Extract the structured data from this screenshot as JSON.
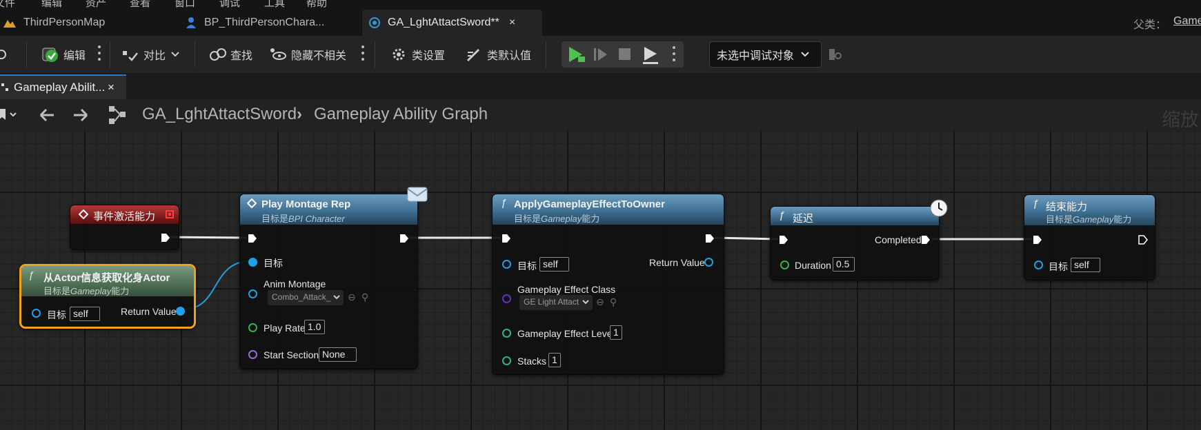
{
  "menu": [
    "文件",
    "编辑",
    "资产",
    "查看",
    "窗口",
    "调试",
    "工具",
    "帮助"
  ],
  "tabs": [
    {
      "label": "ThirdPersonMap"
    },
    {
      "label": "BP_ThirdPersonChara..."
    },
    {
      "label": "GA_LghtAttactSword**",
      "close": "×"
    }
  ],
  "parent_class": {
    "label": "父类：",
    "value": "Game"
  },
  "toolbar": {
    "compile": "编辑",
    "diff": "对比",
    "find": "查找",
    "hide_unrelated": "隐藏不相关",
    "class_settings": "类设置",
    "class_defaults": "类默认值",
    "debug_select": "未选中调试对象"
  },
  "graph_tab": {
    "label": "Gameplay Abilit...",
    "close": "×"
  },
  "breadcrumb": {
    "asset": "GA_LghtAttactSword",
    "separator": "›",
    "graph": "Gameplay Ability Graph"
  },
  "zoom_label": "缩放",
  "nodes": {
    "event": {
      "title": "事件激活能力"
    },
    "get_avatar": {
      "title": "从Actor信息获取化身Actor",
      "subtitle_prefix": "目标是",
      "subtitle_class": "Gameplay",
      "subtitle_suffix": "能力",
      "target_label": "目标",
      "target_value": "self",
      "return_label": "Return Value"
    },
    "play_montage": {
      "title": "Play Montage Rep",
      "subtitle_prefix": "目标是",
      "subtitle_class": "BPI Character",
      "target_label": "目标",
      "anim_montage_label": "Anim Montage",
      "anim_montage_value": "Combo_Attack_",
      "play_rate_label": "Play Rate",
      "play_rate_value": "1.0",
      "start_section_label": "Start Section",
      "start_section_value": "None"
    },
    "apply_effect": {
      "title": "ApplyGameplayEffectToOwner",
      "subtitle_prefix": "目标是",
      "subtitle_class": "Gameplay",
      "subtitle_suffix": "能力",
      "target_label": "目标",
      "target_value": "self",
      "return_label": "Return Value",
      "effect_class_label": "Gameplay Effect Class",
      "effect_class_value": "GE Light Attact",
      "effect_level_label": "Gameplay Effect Level",
      "effect_level_value": "1",
      "stacks_label": "Stacks",
      "stacks_value": "1"
    },
    "delay": {
      "title": "延迟",
      "completed_label": "Completed",
      "duration_label": "Duration",
      "duration_value": "0.5"
    },
    "end_ability": {
      "title": "结束能力",
      "subtitle_prefix": "目标是",
      "subtitle_class": "Gameplay",
      "subtitle_suffix": "能力",
      "target_label": "目标",
      "target_value": "self"
    }
  },
  "colors": {
    "exec_wire": "#e8e8e8",
    "object_pin": "#1fa0e8",
    "float_pin": "#37b24a",
    "int_pin": "#2bb39a",
    "name_pin": "#9a6ccf",
    "class_pin": "#6a2fc3",
    "selection": "#f2a21a"
  }
}
